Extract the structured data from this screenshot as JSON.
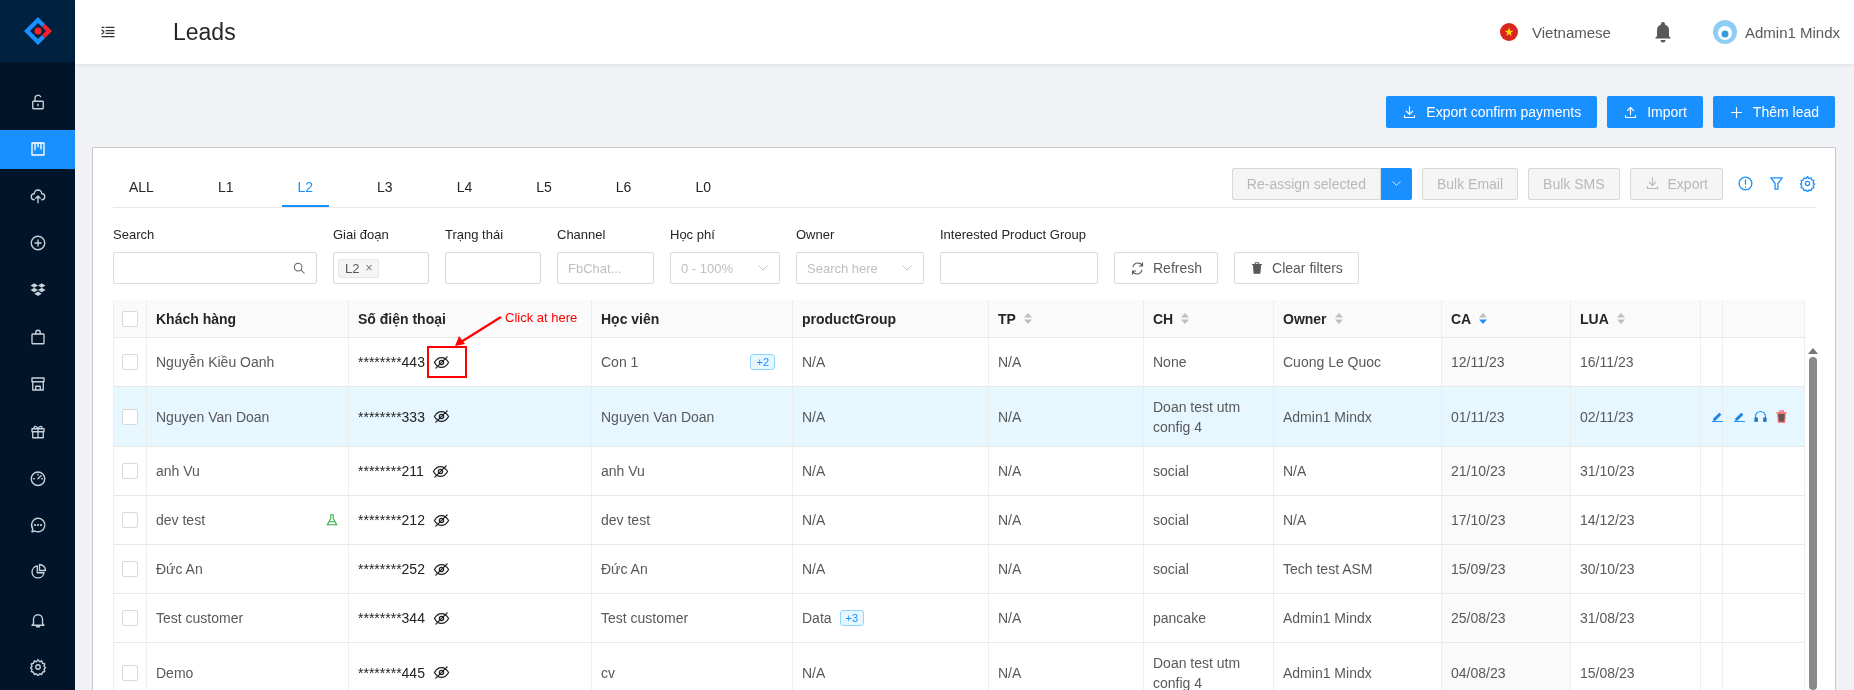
{
  "sidebar": {
    "items": [
      {
        "kind": "unlock",
        "selected": false
      },
      {
        "kind": "board",
        "selected": true
      },
      {
        "kind": "cloud-upload",
        "selected": false
      },
      {
        "kind": "plus-circle",
        "selected": false
      },
      {
        "kind": "dropbox",
        "selected": false
      },
      {
        "kind": "bag",
        "selected": false
      },
      {
        "kind": "shop",
        "selected": false
      },
      {
        "kind": "gift",
        "selected": false
      },
      {
        "kind": "dashboard",
        "selected": false
      },
      {
        "kind": "message",
        "selected": false
      },
      {
        "kind": "pie",
        "selected": false
      },
      {
        "kind": "bell",
        "selected": false
      },
      {
        "kind": "setting",
        "selected": false
      }
    ]
  },
  "header": {
    "title": "Leads",
    "language": "Vietnamese",
    "user": "Admin1 Mindx"
  },
  "actions": [
    {
      "label": "Export confirm payments",
      "kind": "download"
    },
    {
      "label": "Import",
      "kind": "upload"
    },
    {
      "label": "Thêm lead",
      "kind": "plus"
    }
  ],
  "tabs": [
    {
      "label": "ALL",
      "selected": false
    },
    {
      "label": "L1",
      "selected": false
    },
    {
      "label": "L2",
      "selected": true
    },
    {
      "label": "L3",
      "selected": false
    },
    {
      "label": "L4",
      "selected": false
    },
    {
      "label": "L5",
      "selected": false
    },
    {
      "label": "L6",
      "selected": false
    },
    {
      "label": "L0",
      "selected": false
    }
  ],
  "toolbar": {
    "buttons": [
      {
        "label": "Re-assign selected",
        "kind": "split",
        "disabled": true
      },
      {
        "label": "Bulk Email",
        "kind": "plain",
        "disabled": true
      },
      {
        "label": "Bulk SMS",
        "kind": "plain",
        "disabled": true
      },
      {
        "label": "Export",
        "kind": "download",
        "disabled": true
      }
    ]
  },
  "filters": [
    {
      "label": "Search",
      "kind": "search"
    },
    {
      "label": "Giai đoạn",
      "kind": "tags",
      "tags": [
        {
          "label": "L2",
          "remove": "×"
        }
      ]
    },
    {
      "label": "Trạng thái",
      "kind": "text"
    },
    {
      "label": "Channel",
      "kind": "text",
      "placeholder": "FbChat..."
    },
    {
      "label": "Học phí",
      "kind": "select",
      "value": "0 - 100%"
    },
    {
      "label": "Owner",
      "kind": "select",
      "placeholder": "Search here"
    },
    {
      "label": "Interested Product Group",
      "kind": "text"
    }
  ],
  "filter_buttons": [
    {
      "label": "Refresh",
      "kind": "refresh"
    },
    {
      "label": "Clear filters",
      "kind": "delete"
    }
  ],
  "table": {
    "select_all_checked": false,
    "columns": [
      {
        "label": "Khách hàng",
        "sortable": false
      },
      {
        "label": "Số điện thoại",
        "sortable": false
      },
      {
        "label": "Học viên",
        "sortable": false
      },
      {
        "label": "productGroup",
        "sortable": false
      },
      {
        "label": "TP",
        "sortable": true,
        "sorted_descending": false
      },
      {
        "label": "CH",
        "sortable": true,
        "sorted_descending": false
      },
      {
        "label": "Owner",
        "sortable": true,
        "sorted_descending": false
      },
      {
        "label": "CA",
        "sortable": true,
        "sorted_descending": true
      },
      {
        "label": "LUA",
        "sortable": true,
        "sorted_descending": false
      }
    ],
    "rows": [
      {
        "checked": false,
        "hovered": false,
        "customer": "Nguyễn Kiều Oanh",
        "flagged": false,
        "phone": "********443",
        "student": "Con 1",
        "student_more": "+2",
        "product": "N/A",
        "tp": "N/A",
        "ch": "None",
        "owner": "Cuong Le Quoc",
        "ca": "12/11/23",
        "lua": "16/11/23"
      },
      {
        "checked": false,
        "hovered": true,
        "customer": "Nguyen Van Doan",
        "flagged": false,
        "phone": "********333",
        "student": "Nguyen Van Doan",
        "product": "N/A",
        "tp": "N/A",
        "ch": "Doan test utm config 4",
        "owner": "Admin1 Mindx",
        "ca": "01/11/23",
        "lua": "02/11/23"
      },
      {
        "checked": false,
        "hovered": false,
        "customer": "anh Vu",
        "flagged": false,
        "phone": "********211",
        "student": "anh Vu",
        "product": "N/A",
        "tp": "N/A",
        "ch": "social",
        "owner": "N/A",
        "ca": "21/10/23",
        "lua": "31/10/23"
      },
      {
        "checked": false,
        "hovered": false,
        "customer": "dev test",
        "flagged": true,
        "phone": "********212",
        "student": "dev test",
        "product": "N/A",
        "tp": "N/A",
        "ch": "social",
        "owner": "N/A",
        "ca": "17/10/23",
        "lua": "14/12/23"
      },
      {
        "checked": false,
        "hovered": false,
        "customer": "Đức An",
        "flagged": false,
        "phone": "********252",
        "student": "Đức An",
        "product": "N/A",
        "tp": "N/A",
        "ch": "social",
        "owner": "Tech test ASM",
        "ca": "15/09/23",
        "lua": "30/10/23"
      },
      {
        "checked": false,
        "hovered": false,
        "customer": "Test customer",
        "flagged": false,
        "phone": "********344",
        "student": "Test customer",
        "product": "Data",
        "product_more": "+3",
        "tp": "N/A",
        "ch": "pancake",
        "owner": "Admin1 Mindx",
        "ca": "25/08/23",
        "lua": "31/08/23"
      },
      {
        "checked": false,
        "hovered": false,
        "customer": "Demo",
        "flagged": false,
        "phone": "********445",
        "student": "cv",
        "product": "N/A",
        "tp": "N/A",
        "ch": "Doan test utm config 4",
        "owner": "Admin1 Mindx",
        "ca": "04/08/23",
        "lua": "15/08/23"
      }
    ]
  },
  "annotation": {
    "text": "Click at here"
  }
}
